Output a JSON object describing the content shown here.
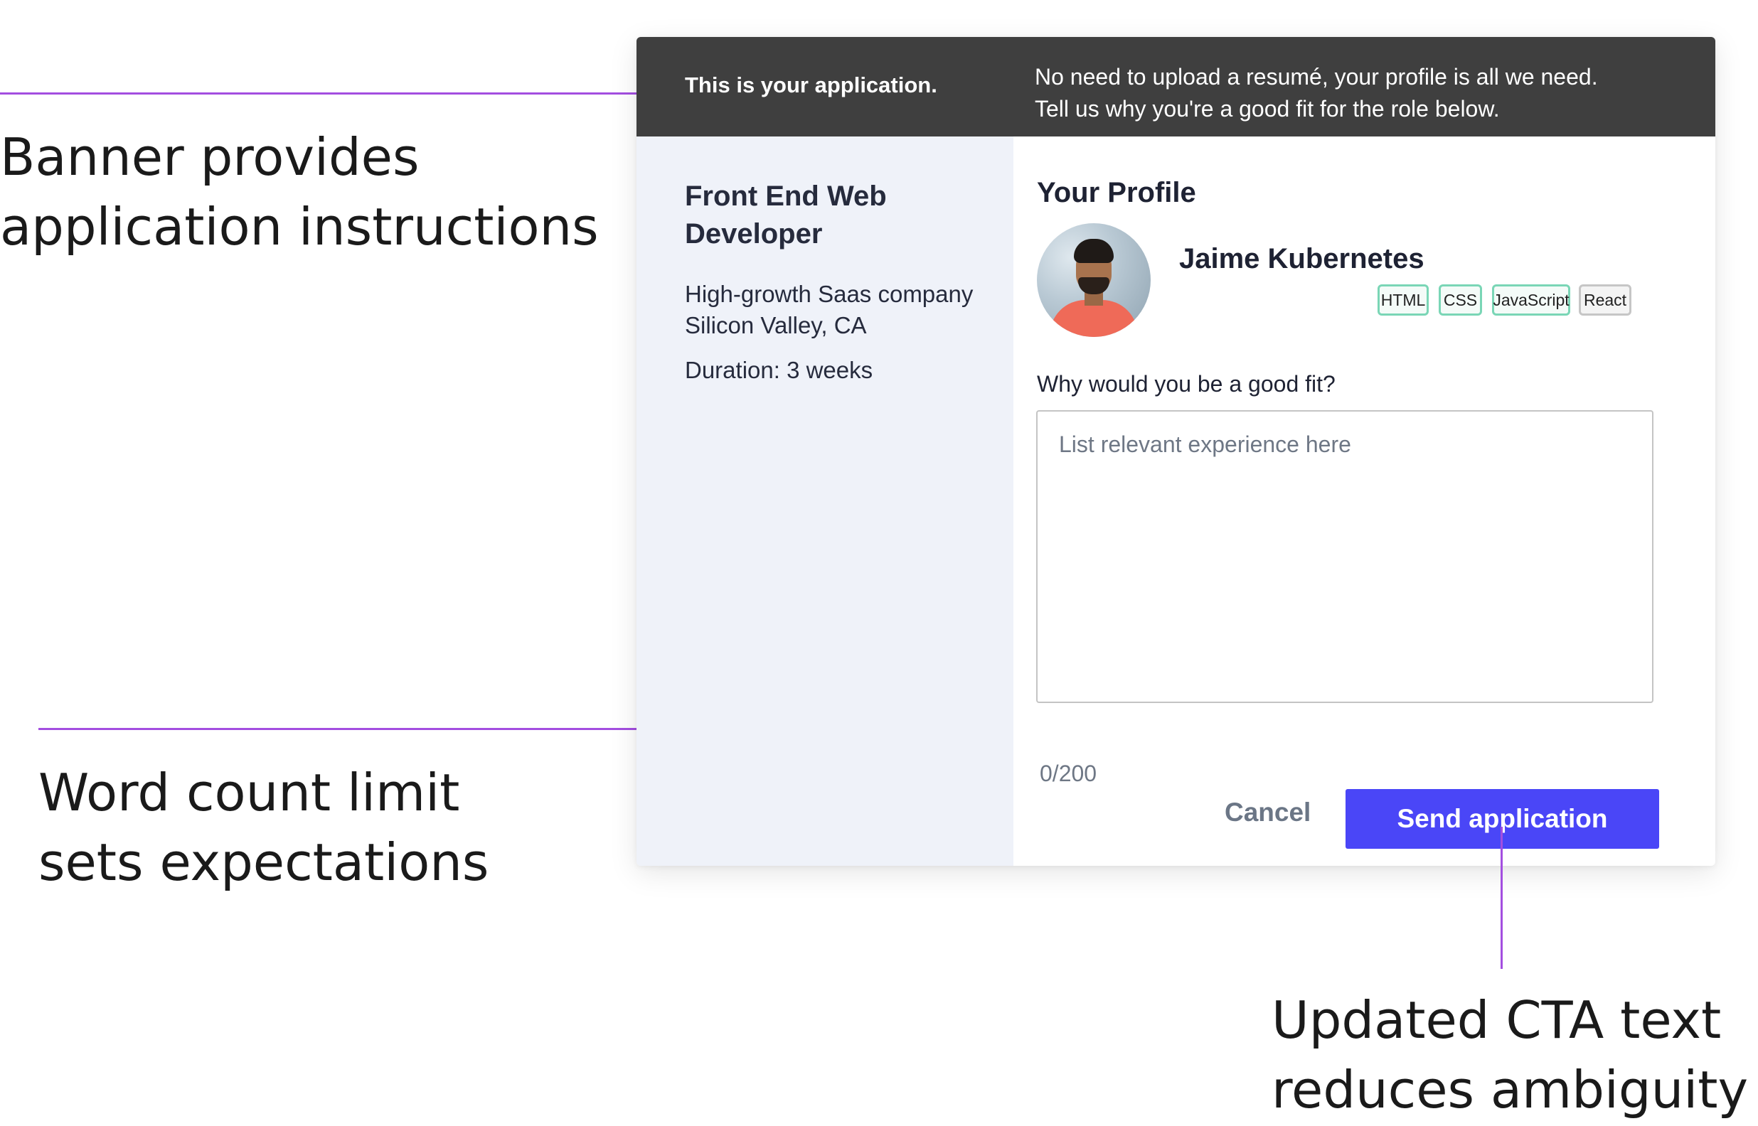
{
  "annotations": {
    "banner": [
      "Banner provides",
      "application instructions"
    ],
    "word_count": [
      "Word count limit",
      "sets expectations"
    ],
    "cta": [
      "Updated CTA text",
      "reduces ambiguity"
    ]
  },
  "banner": {
    "title": "This is your application.",
    "message": [
      "No need to upload a resumé, your profile is all we need.",
      "Tell us why you're a good fit for the role below."
    ]
  },
  "job": {
    "title": [
      "Front End Web",
      "Developer"
    ],
    "company": "High-growth Saas company",
    "location": "Silicon Valley, CA",
    "duration": "Duration: 3 weeks"
  },
  "profile": {
    "heading": "Your Profile",
    "name": "Jaime Kubernetes",
    "skills": [
      "HTML",
      "CSS",
      "JavaScript",
      "React"
    ],
    "avatar_icon": "person-photo"
  },
  "form": {
    "question": "Why would you be a good fit?",
    "placeholder": "List relevant experience here",
    "counter": "0/200",
    "cancel_label": "Cancel",
    "submit_label": "Send application"
  },
  "colors": {
    "annotation_line": "#a34ee0",
    "banner_bg": "#3f3f3f",
    "left_pane_bg": "#eff2f9",
    "primary_button": "#4a46f7",
    "skill_chip_border": "#7ad6b6"
  }
}
